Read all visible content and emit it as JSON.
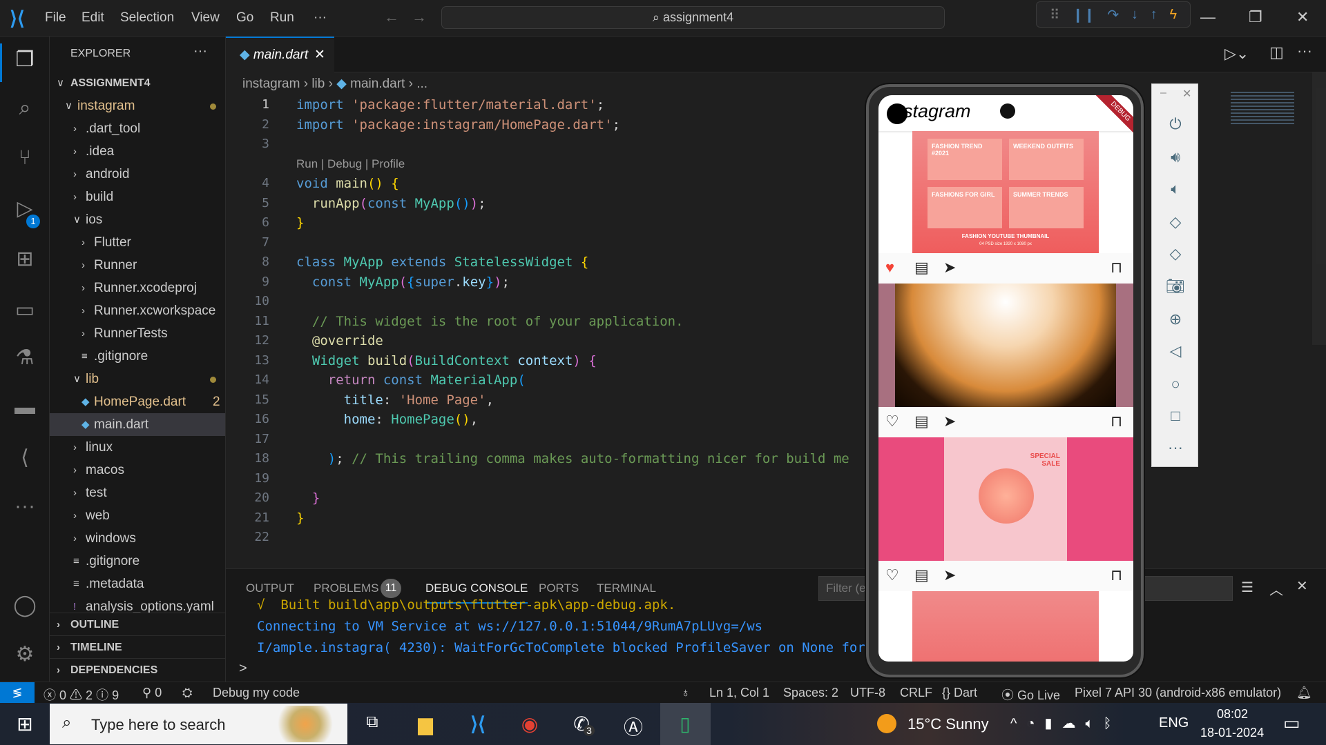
{
  "titlebar": {
    "menus": [
      "File",
      "Edit",
      "Selection",
      "View",
      "Go",
      "Run",
      "···"
    ],
    "search": "assignment4"
  },
  "activity": {
    "debug_badge": "1"
  },
  "explorer": {
    "title": "EXPLORER",
    "more": "···",
    "root": "ASSIGNMENT4",
    "items": [
      {
        "label": "instagram",
        "level": 0,
        "type": "folder-open",
        "color": "#e2c08d",
        "dot": true
      },
      {
        "label": ".dart_tool",
        "level": 1,
        "type": "folder"
      },
      {
        "label": ".idea",
        "level": 1,
        "type": "folder"
      },
      {
        "label": "android",
        "level": 1,
        "type": "folder"
      },
      {
        "label": "build",
        "level": 1,
        "type": "folder"
      },
      {
        "label": "ios",
        "level": 1,
        "type": "folder-open"
      },
      {
        "label": "Flutter",
        "level": 2,
        "type": "folder"
      },
      {
        "label": "Runner",
        "level": 2,
        "type": "folder"
      },
      {
        "label": "Runner.xcodeproj",
        "level": 2,
        "type": "folder"
      },
      {
        "label": "Runner.xcworkspace",
        "level": 2,
        "type": "folder"
      },
      {
        "label": "RunnerTests",
        "level": 2,
        "type": "folder"
      },
      {
        "label": ".gitignore",
        "level": 2,
        "type": "file-lines"
      },
      {
        "label": "lib",
        "level": 1,
        "type": "folder-open",
        "color": "#e2c08d",
        "dot": true
      },
      {
        "label": "HomePage.dart",
        "level": 2,
        "type": "dart",
        "color": "#e2c08d",
        "badge": "2"
      },
      {
        "label": "main.dart",
        "level": 2,
        "type": "dart",
        "selected": true
      },
      {
        "label": "linux",
        "level": 1,
        "type": "folder"
      },
      {
        "label": "macos",
        "level": 1,
        "type": "folder"
      },
      {
        "label": "test",
        "level": 1,
        "type": "folder"
      },
      {
        "label": "web",
        "level": 1,
        "type": "folder"
      },
      {
        "label": "windows",
        "level": 1,
        "type": "folder"
      },
      {
        "label": ".gitignore",
        "level": 1,
        "type": "file-lines"
      },
      {
        "label": ".metadata",
        "level": 1,
        "type": "file-lines"
      },
      {
        "label": "analysis_options.yaml",
        "level": 1,
        "type": "yaml"
      }
    ],
    "sections": [
      "OUTLINE",
      "TIMELINE",
      "DEPENDENCIES"
    ]
  },
  "editor": {
    "tab": "main.dart",
    "breadcrumb": [
      "instagram",
      "lib",
      "main.dart",
      "..."
    ],
    "codelens": "Run | Debug | Profile",
    "lines": [
      [
        [
          "import ",
          "kw"
        ],
        [
          "'package:flutter/material.dart'",
          "str"
        ],
        [
          ";",
          "pl"
        ]
      ],
      [
        [
          "import ",
          "kw"
        ],
        [
          "'package:instagram/HomePage.dart'",
          "str"
        ],
        [
          ";",
          "pl"
        ]
      ],
      [],
      [
        [
          "void ",
          "kw"
        ],
        [
          "main",
          "fn"
        ],
        [
          "() ",
          "b1"
        ],
        [
          "{",
          "b1"
        ]
      ],
      [
        [
          "  runApp",
          "fn"
        ],
        [
          "(",
          "b2"
        ],
        [
          "const ",
          "kw"
        ],
        [
          "MyApp",
          "cls"
        ],
        [
          "()",
          "b3"
        ],
        [
          ")",
          "b2"
        ],
        [
          ";",
          "pl"
        ]
      ],
      [
        [
          "}",
          "b1"
        ]
      ],
      [],
      [
        [
          "class ",
          "kw"
        ],
        [
          "MyApp ",
          "cls"
        ],
        [
          "extends ",
          "kw"
        ],
        [
          "StatelessWidget ",
          "cls"
        ],
        [
          "{",
          "b1"
        ]
      ],
      [
        [
          "  const ",
          "kw"
        ],
        [
          "MyApp",
          "cls"
        ],
        [
          "(",
          "b2"
        ],
        [
          "{",
          "b3"
        ],
        [
          "super",
          "kw"
        ],
        [
          ".",
          "pl"
        ],
        [
          "key",
          "var"
        ],
        [
          "}",
          "b3"
        ],
        [
          ")",
          "b2"
        ],
        [
          ";",
          "pl"
        ]
      ],
      [],
      [
        [
          "  // This widget is the root of your application.",
          "cm"
        ]
      ],
      [
        [
          "  @override",
          "fn"
        ]
      ],
      [
        [
          "  Widget ",
          "cls"
        ],
        [
          "build",
          "fn"
        ],
        [
          "(",
          "b2"
        ],
        [
          "BuildContext ",
          "cls"
        ],
        [
          "context",
          "var"
        ],
        [
          ") ",
          "b2"
        ],
        [
          "{",
          "b2"
        ]
      ],
      [
        [
          "    return ",
          "ctl"
        ],
        [
          "const ",
          "kw"
        ],
        [
          "MaterialApp",
          "cls"
        ],
        [
          "(",
          "b3"
        ]
      ],
      [
        [
          "      title",
          "var"
        ],
        [
          ": ",
          "pl"
        ],
        [
          "'Home Page'",
          "str"
        ],
        [
          ",",
          "pl"
        ]
      ],
      [
        [
          "      home",
          "var"
        ],
        [
          ": ",
          "pl"
        ],
        [
          "HomePage",
          "cls"
        ],
        [
          "()",
          "b1"
        ],
        [
          ",",
          "pl"
        ]
      ],
      [],
      [
        [
          "    )",
          "b3"
        ],
        [
          "; ",
          "pl"
        ],
        [
          "// This trailing comma makes auto-formatting nicer for build me",
          "cm"
        ]
      ],
      [],
      [
        [
          "  }",
          "b2"
        ]
      ],
      [
        [
          "}",
          "b1"
        ]
      ],
      []
    ]
  },
  "panel": {
    "tabs": [
      "OUTPUT",
      "PROBLEMS",
      "DEBUG CONSOLE",
      "PORTS",
      "TERMINAL"
    ],
    "problems_count": "11",
    "filter_placeholder": "Filter (e.g. text, !exclude)",
    "console": [
      {
        "text": "√  Built build\\app\\outputs\\flutter-apk\\app-debug.apk.",
        "color": "#cca700"
      },
      {
        "text": "Connecting to VM Service at ws://127.0.0.1:51044/9RumA7pLUvg=/ws",
        "color": "#3794ff"
      },
      {
        "text": "I/ample.instagra( 4230): WaitForGcToComplete blocked ProfileSaver on None for",
        "color": "#3794ff"
      }
    ],
    "prompt": ">"
  },
  "statusbar": {
    "errors": "0",
    "warnings": "2",
    "infos": "9",
    "ports": "0",
    "debug": "Debug my code",
    "position": "Ln 1, Col 1",
    "spaces": "Spaces: 2",
    "encoding": "UTF-8",
    "eol": "CRLF",
    "language": "Dart",
    "golive": "Go Live",
    "device": "Pixel 7 API 30 (android-x86 emulator)"
  },
  "phone": {
    "app_title": "stagram",
    "debug_banner": "DEBUG",
    "post1": {
      "caption": "FASHION YOUTUBE THUMBNAIL",
      "sub": "04 PSD size 1920 x 1080 px",
      "cards": [
        "FASHION TREND #2021",
        "WEEKEND OUTFITS",
        "FASHIONS FOR GIRL",
        "SUMMER TRENDS"
      ]
    },
    "post3": {
      "card": "SPECIAL SALE"
    }
  },
  "taskbar": {
    "search_placeholder": "Type here to search",
    "weather": "15°C  Sunny",
    "lang": "ENG",
    "time": "08:02",
    "date": "18-01-2024",
    "whatsapp_badge": "3"
  }
}
